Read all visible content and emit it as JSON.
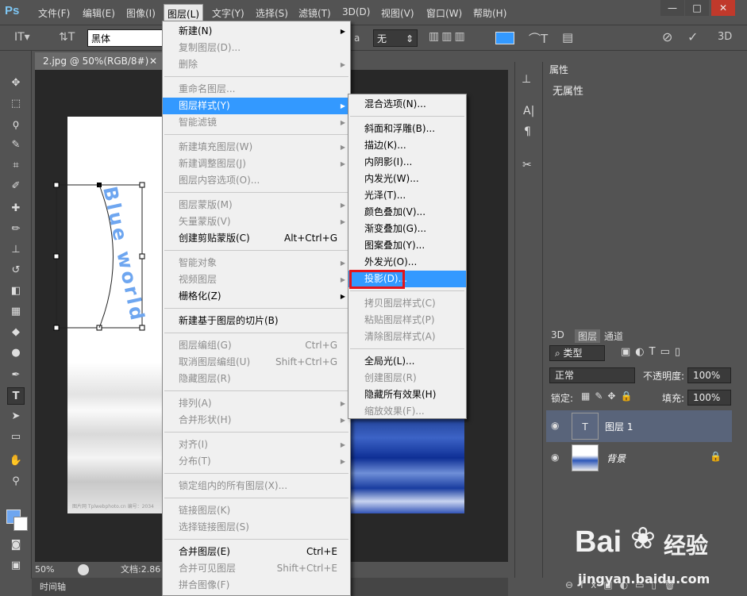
{
  "app": {
    "logo": "Ps"
  },
  "menubar": [
    "文件(F)",
    "编辑(E)",
    "图像(I)",
    "图层(L)",
    "文字(Y)",
    "选择(S)",
    "滤镜(T)",
    "3D(D)",
    "视图(V)",
    "窗口(W)",
    "帮助(H)"
  ],
  "window_controls": [
    "—",
    "□",
    "✕"
  ],
  "options": {
    "font_family": "黑体",
    "antialias": "无",
    "aa_label": "a"
  },
  "document": {
    "tab": "2.jpg @ 50%(RGB/8#)",
    "zoom": "50%",
    "doc_info": "文档:2.86",
    "timeline": "时间轴",
    "text_art": "Blue world",
    "credit": "图片网 Tplwebphoto.cn 编号：2034"
  },
  "layer_menu": [
    {
      "label": "新建(N)",
      "arrow": true,
      "enabled": true
    },
    {
      "label": "复制图层(D)...",
      "enabled": false
    },
    {
      "label": "删除",
      "arrow": true,
      "enabled": false
    },
    {
      "label": "重命名图层...",
      "enabled": false
    },
    {
      "label": "图层样式(Y)",
      "arrow": true,
      "enabled": true,
      "highlight": true
    },
    {
      "label": "智能滤镜",
      "arrow": true,
      "enabled": false
    },
    {
      "label": "新建填充图层(W)",
      "arrow": true,
      "enabled": false
    },
    {
      "label": "新建调整图层(J)",
      "arrow": true,
      "enabled": false
    },
    {
      "label": "图层内容选项(O)...",
      "enabled": false
    },
    {
      "label": "图层蒙版(M)",
      "arrow": true,
      "enabled": false
    },
    {
      "label": "矢量蒙版(V)",
      "arrow": true,
      "enabled": false
    },
    {
      "label": "创建剪贴蒙版(C)",
      "shortcut": "Alt+Ctrl+G",
      "enabled": true
    },
    {
      "label": "智能对象",
      "arrow": true,
      "enabled": false
    },
    {
      "label": "视频图层",
      "arrow": true,
      "enabled": false
    },
    {
      "label": "栅格化(Z)",
      "arrow": true,
      "enabled": true
    },
    {
      "label": "新建基于图层的切片(B)",
      "enabled": true
    },
    {
      "label": "图层编组(G)",
      "shortcut": "Ctrl+G",
      "enabled": false
    },
    {
      "label": "取消图层编组(U)",
      "shortcut": "Shift+Ctrl+G",
      "enabled": false
    },
    {
      "label": "隐藏图层(R)",
      "enabled": false
    },
    {
      "label": "排列(A)",
      "arrow": true,
      "enabled": false
    },
    {
      "label": "合并形状(H)",
      "arrow": true,
      "enabled": false
    },
    {
      "label": "对齐(I)",
      "arrow": true,
      "enabled": false
    },
    {
      "label": "分布(T)",
      "arrow": true,
      "enabled": false
    },
    {
      "label": "锁定组内的所有图层(X)...",
      "enabled": false
    },
    {
      "label": "链接图层(K)",
      "enabled": false
    },
    {
      "label": "选择链接图层(S)",
      "enabled": false
    },
    {
      "label": "合并图层(E)",
      "shortcut": "Ctrl+E",
      "enabled": true
    },
    {
      "label": "合并可见图层",
      "shortcut": "Shift+Ctrl+E",
      "enabled": false
    },
    {
      "label": "拼合图像(F)",
      "enabled": false
    }
  ],
  "style_menu": [
    {
      "label": "混合选项(N)...",
      "enabled": true
    },
    {
      "label": "斜面和浮雕(B)...",
      "enabled": true
    },
    {
      "label": "描边(K)...",
      "enabled": true
    },
    {
      "label": "内阴影(I)...",
      "enabled": true
    },
    {
      "label": "内发光(W)...",
      "enabled": true
    },
    {
      "label": "光泽(T)...",
      "enabled": true
    },
    {
      "label": "颜色叠加(V)...",
      "enabled": true
    },
    {
      "label": "渐变叠加(G)...",
      "enabled": true
    },
    {
      "label": "图案叠加(Y)...",
      "enabled": true
    },
    {
      "label": "外发光(O)...",
      "enabled": true
    },
    {
      "label": "投影(D)...",
      "enabled": true,
      "highlight": true
    },
    {
      "label": "拷贝图层样式(C)",
      "enabled": false
    },
    {
      "label": "粘贴图层样式(P)",
      "enabled": false
    },
    {
      "label": "清除图层样式(A)",
      "enabled": false
    },
    {
      "label": "全局光(L)...",
      "enabled": true
    },
    {
      "label": "创建图层(R)",
      "enabled": false
    },
    {
      "label": "隐藏所有效果(H)",
      "enabled": true
    },
    {
      "label": "缩放效果(F)...",
      "enabled": false
    }
  ],
  "properties": {
    "title": "属性",
    "body": "无属性"
  },
  "layers": {
    "tabs": [
      "3D",
      "图层",
      "通道"
    ],
    "filter": "类型",
    "blend": "正常",
    "opacity_label": "不透明度:",
    "opacity": "100%",
    "lock_label": "锁定:",
    "fill_label": "填充:",
    "fill": "100%",
    "items": [
      {
        "name": "图层 1",
        "selected": true
      },
      {
        "name": "背景",
        "locked": true
      }
    ]
  },
  "watermark": {
    "brand": "Bai",
    "brand2": "经验",
    "url": "jingyan.baidu.com"
  },
  "colors": {
    "accent": "#3399ff",
    "highlight_box": "#e3141b",
    "text_art": "#6ea6f0"
  }
}
